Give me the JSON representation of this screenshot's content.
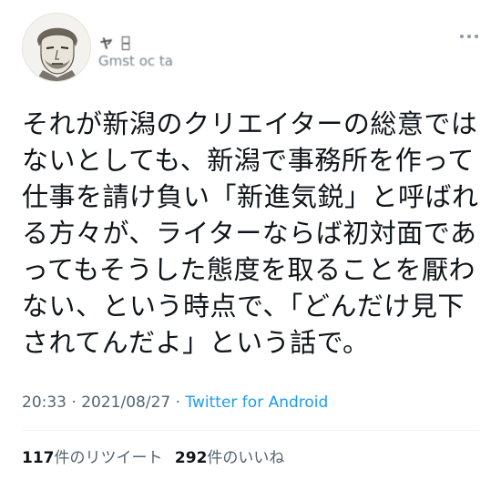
{
  "author": {
    "display_name": "ャ ｯ̵",
    "handle": "Gmst oc ta"
  },
  "tweet": {
    "text": "それが新潟のクリエイターの総意では\nないとしても、新潟で事務所を作って\n仕事を請け負い「新進気鋭」と呼ばれ\nる方々が、ライターならば初対面であ\nってもそうした態度を取ることを厭わ\nない、という時点で、「どんだけ見下\nされてんだよ」という話で。",
    "time": "20:33",
    "separator1": " · ",
    "date": "2021/08/27",
    "separator2": " · ",
    "source": "Twitter for Android"
  },
  "stats": {
    "retweets_count": "117",
    "retweets_label": "件のリツイート",
    "likes_count": "292",
    "likes_label": "件のいいね"
  },
  "icons": {
    "more": "more-horizontal-icon",
    "avatar": "avatar-portrait"
  }
}
